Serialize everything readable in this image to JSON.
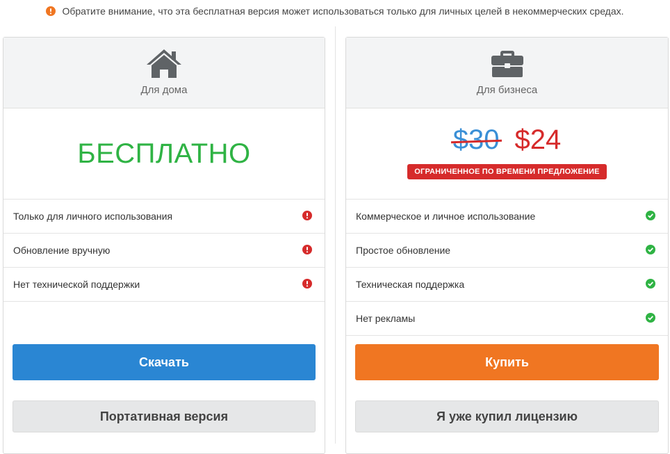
{
  "notice": {
    "text": "Обратите внимание, что эта бесплатная версия может использоваться только для личных целей в некоммерческих средах.",
    "icon": "exclamation-circle-icon",
    "color": "#f07622"
  },
  "home": {
    "icon": "house-icon",
    "title": "Для дома",
    "price_label": "БЕСПЛАТНО",
    "features": [
      {
        "label": "Только для личного использования",
        "icon": "error-icon"
      },
      {
        "label": "Обновление вручную",
        "icon": "error-icon"
      },
      {
        "label": "Нет технической поддержки",
        "icon": "error-icon"
      }
    ],
    "primary_button": "Скачать",
    "secondary_button": "Портативная версия"
  },
  "business": {
    "icon": "briefcase-icon",
    "title": "Для бизнеса",
    "old_price": "$30",
    "new_price": "$24",
    "offer_badge": "ОГРАНИЧЕННОЕ ПО ВРЕМЕНИ ПРЕДЛОЖЕНИЕ",
    "features": [
      {
        "label": "Коммерческое и личное использование",
        "icon": "check-icon"
      },
      {
        "label": "Простое обновление",
        "icon": "check-icon"
      },
      {
        "label": "Техническая поддержка",
        "icon": "check-icon"
      },
      {
        "label": "Нет рекламы",
        "icon": "check-icon"
      }
    ],
    "primary_button": "Купить",
    "secondary_button": "Я уже купил лицензию"
  },
  "colors": {
    "free_green": "#2fb344",
    "error_red": "#d62b2b",
    "download_blue": "#2a86d3",
    "buy_orange": "#f07622",
    "old_price_blue": "#3a8fd6"
  }
}
